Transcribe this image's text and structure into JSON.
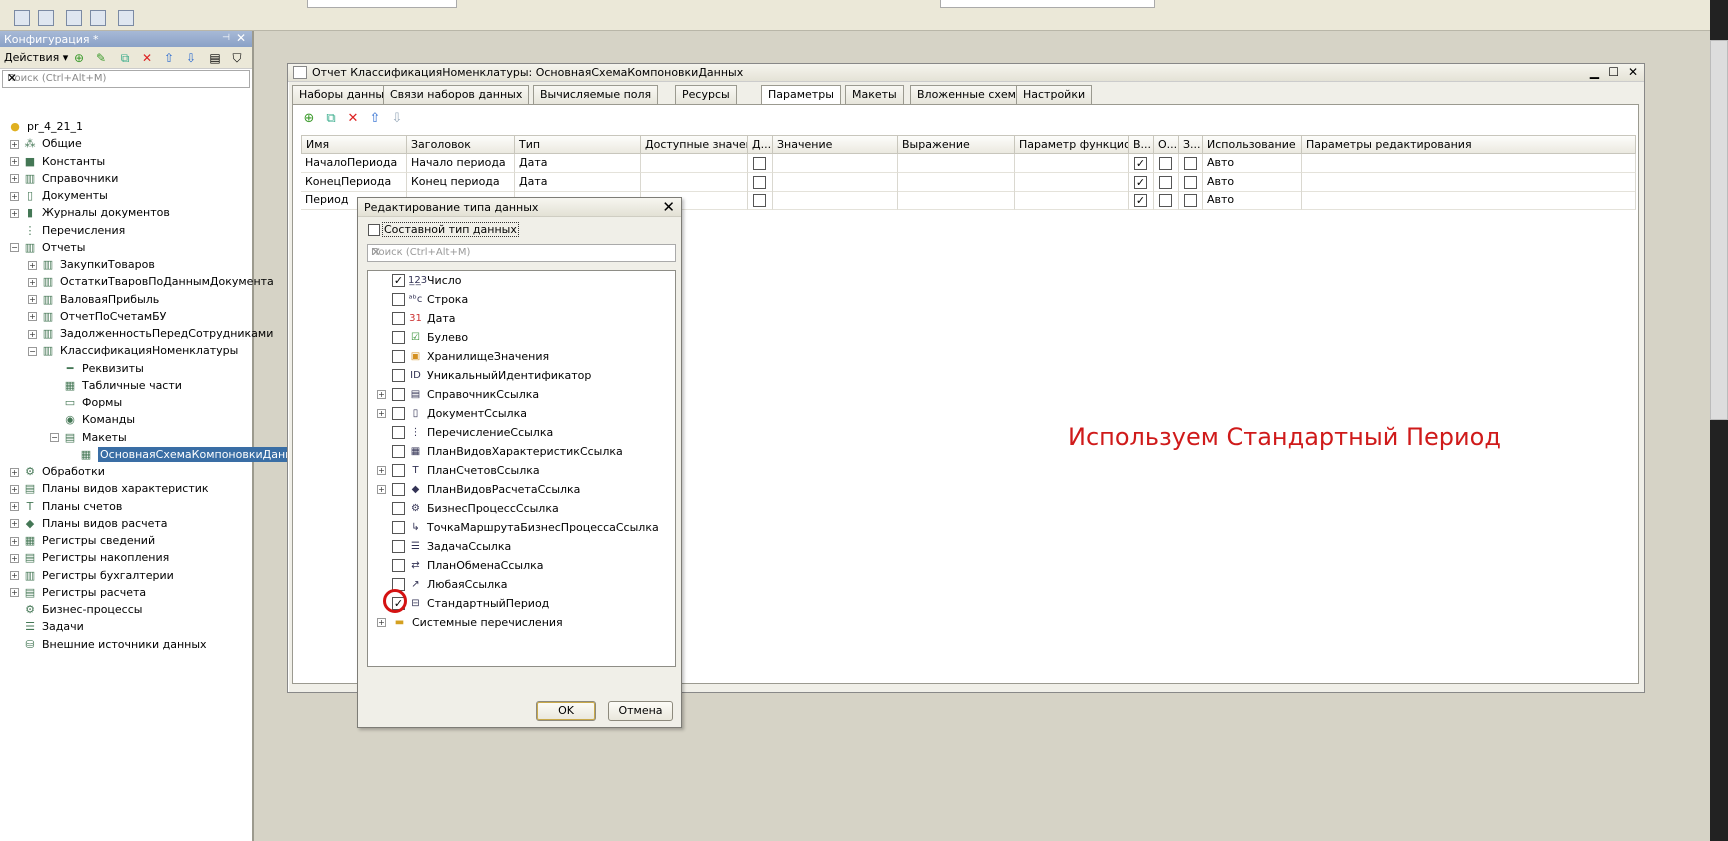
{
  "left_panel": {
    "title": "Конфигурация *",
    "actions_label": "Действия ▾",
    "search_placeholder": "Поиск (Ctrl+Alt+M)",
    "tree": [
      {
        "label": "pr_4_21_1",
        "indent": 0,
        "icon": "config-icon",
        "exp": ""
      },
      {
        "label": "Общие",
        "indent": 1,
        "icon": "common-icon",
        "exp": "+"
      },
      {
        "label": "Константы",
        "indent": 1,
        "icon": "constants-icon",
        "exp": "+"
      },
      {
        "label": "Справочники",
        "indent": 1,
        "icon": "catalogs-icon",
        "exp": "+"
      },
      {
        "label": "Документы",
        "indent": 1,
        "icon": "documents-icon",
        "exp": "+"
      },
      {
        "label": "Журналы документов",
        "indent": 1,
        "icon": "journals-icon",
        "exp": "+"
      },
      {
        "label": "Перечисления",
        "indent": 1,
        "icon": "enums-icon",
        "exp": ""
      },
      {
        "label": "Отчеты",
        "indent": 1,
        "icon": "reports-icon",
        "exp": "−"
      },
      {
        "label": "ЗакупкиТоваров",
        "indent": 2,
        "icon": "report-icon",
        "exp": "+"
      },
      {
        "label": "ОстаткиТвaровПоДаннымДокумента",
        "indent": 2,
        "icon": "report-icon",
        "exp": "+"
      },
      {
        "label": "ВаловаяПрибыль",
        "indent": 2,
        "icon": "report-icon",
        "exp": "+"
      },
      {
        "label": "ОтчетПоСчетамБУ",
        "indent": 2,
        "icon": "report-icon",
        "exp": "+"
      },
      {
        "label": "ЗадолженностьПередСотрудниками",
        "indent": 2,
        "icon": "report-icon",
        "exp": "+"
      },
      {
        "label": "КлассификацияНоменклатуры",
        "indent": 2,
        "icon": "report-icon",
        "exp": "−"
      },
      {
        "label": "Реквизиты",
        "indent": 3,
        "icon": "attributes-icon",
        "exp": ""
      },
      {
        "label": "Табличные части",
        "indent": 3,
        "icon": "tabular-icon",
        "exp": ""
      },
      {
        "label": "Формы",
        "indent": 3,
        "icon": "forms-icon",
        "exp": ""
      },
      {
        "label": "Команды",
        "indent": 3,
        "icon": "commands-icon",
        "exp": ""
      },
      {
        "label": "Макеты",
        "indent": 3,
        "icon": "templates-icon",
        "exp": "−"
      },
      {
        "label": "ОсновнаяСхемаКомпоновкиДанных",
        "indent": 4,
        "icon": "schema-icon",
        "exp": "",
        "selected": true
      },
      {
        "label": "Обработки",
        "indent": 1,
        "icon": "dataprocessors-icon",
        "exp": "+"
      },
      {
        "label": "Планы видов характеристик",
        "indent": 1,
        "icon": "chartsofchar-icon",
        "exp": "+"
      },
      {
        "label": "Планы счетов",
        "indent": 1,
        "icon": "chartsofaccounts-icon",
        "exp": "+"
      },
      {
        "label": "Планы видов расчета",
        "indent": 1,
        "icon": "chartsofcalc-icon",
        "exp": "+"
      },
      {
        "label": "Регистры сведений",
        "indent": 1,
        "icon": "inforeg-icon",
        "exp": "+"
      },
      {
        "label": "Регистры накопления",
        "indent": 1,
        "icon": "accumreg-icon",
        "exp": "+"
      },
      {
        "label": "Регистры бухгалтерии",
        "indent": 1,
        "icon": "accountreg-icon",
        "exp": "+"
      },
      {
        "label": "Регистры расчета",
        "indent": 1,
        "icon": "calcreg-icon",
        "exp": "+"
      },
      {
        "label": "Бизнес-процессы",
        "indent": 1,
        "icon": "bizproc-icon",
        "exp": ""
      },
      {
        "label": "Задачи",
        "indent": 1,
        "icon": "tasks-icon",
        "exp": ""
      },
      {
        "label": "Внешние источники данных",
        "indent": 1,
        "icon": "extsources-icon",
        "exp": ""
      }
    ]
  },
  "main_window": {
    "title": "Отчет КлассификацияНоменклатуры: ОсновнаяСхемаКомпоновкиДанных",
    "tabs": [
      "Наборы данных",
      "Связи наборов данных",
      "Вычисляемые поля",
      "Ресурсы",
      "Параметры",
      "Макеты",
      "Вложенные схемы",
      "Настройки"
    ],
    "active_tab": "Параметры",
    "columns": [
      "Имя",
      "Заголовок",
      "Тип",
      "Доступные значения",
      "Д...",
      "Значение",
      "Выражение",
      "Параметр функцио...",
      "В...",
      "О...",
      "З...",
      "Использование",
      "Параметры редактирования"
    ],
    "rows": [
      {
        "name": "НачалоПериода",
        "title": "Начало периода",
        "type": "Дата",
        "d": false,
        "b": true,
        "o": false,
        "z": false,
        "usage": "Авто"
      },
      {
        "name": "КонецПериода",
        "title": "Конец периода",
        "type": "Дата",
        "d": false,
        "b": true,
        "o": false,
        "z": false,
        "usage": "Авто"
      },
      {
        "name": "Период",
        "title": "",
        "type": "",
        "d": false,
        "b": true,
        "o": false,
        "z": false,
        "usage": "Авто"
      }
    ],
    "annotation": "Используем Стандартный Период"
  },
  "dialog": {
    "title": "Редактирование типа данных",
    "composite_label": "Составной тип данных",
    "search_placeholder": "Поиск (Ctrl+Alt+M)",
    "types": [
      {
        "label": "Число",
        "checked": true,
        "icon": "number-icon",
        "glyph": "1̲2̲3",
        "exp": false
      },
      {
        "label": "Строка",
        "checked": false,
        "icon": "string-icon",
        "glyph": "ᵃᵇc",
        "exp": false
      },
      {
        "label": "Дата",
        "checked": false,
        "icon": "date-icon",
        "glyph": "31",
        "exp": false
      },
      {
        "label": "Булево",
        "checked": false,
        "icon": "boolean-icon",
        "glyph": "☑",
        "exp": false
      },
      {
        "label": "ХранилищеЗначения",
        "checked": false,
        "icon": "valuestorage-icon",
        "glyph": "▣",
        "exp": false
      },
      {
        "label": "УникальныйИдентификатор",
        "checked": false,
        "icon": "uuid-icon",
        "glyph": "ID",
        "exp": false
      },
      {
        "label": "СправочникСсылка",
        "checked": false,
        "icon": "catalogref-icon",
        "glyph": "▤",
        "exp": true
      },
      {
        "label": "ДокументСсылка",
        "checked": false,
        "icon": "documentref-icon",
        "glyph": "▯",
        "exp": true
      },
      {
        "label": "ПеречислениеСсылка",
        "checked": false,
        "icon": "enumref-icon",
        "glyph": "⋮",
        "exp": false
      },
      {
        "label": "ПланВидовХарактеристикСсылка",
        "checked": false,
        "icon": "chartofcharref-icon",
        "glyph": "▦",
        "exp": false
      },
      {
        "label": "ПланСчетовСсылка",
        "checked": false,
        "icon": "chartofaccountsref-icon",
        "glyph": "T",
        "exp": true
      },
      {
        "label": "ПланВидовРасчетаСсылка",
        "checked": false,
        "icon": "chartofcalcref-icon",
        "glyph": "◆",
        "exp": true
      },
      {
        "label": "БизнесПроцессСсылка",
        "checked": false,
        "icon": "bizprocref-icon",
        "glyph": "⚙",
        "exp": false
      },
      {
        "label": "ТочкаМаршрутаБизнесПроцессаСсылка",
        "checked": false,
        "icon": "routepointref-icon",
        "glyph": "↳",
        "exp": false
      },
      {
        "label": "ЗадачаСсылка",
        "checked": false,
        "icon": "taskref-icon",
        "glyph": "☰",
        "exp": false
      },
      {
        "label": "ПланОбменаСсылка",
        "checked": false,
        "icon": "exchangeplanref-icon",
        "glyph": "⇄",
        "exp": false
      },
      {
        "label": "ЛюбаяСсылка",
        "checked": false,
        "icon": "anyref-icon",
        "glyph": "↗",
        "exp": false
      },
      {
        "label": "СтандартныйПериод",
        "checked": true,
        "icon": "standardperiod-icon",
        "glyph": "⊟",
        "exp": false
      },
      {
        "label": "Системные перечисления",
        "checked": null,
        "icon": "folder-icon",
        "glyph": "▭",
        "exp": true
      }
    ],
    "ok_label": "OK",
    "cancel_label": "Отмена"
  },
  "colors": {
    "accent": "#3a6ea5",
    "annotation": "#cf1a1a",
    "highlight_circle": "#d41212"
  }
}
